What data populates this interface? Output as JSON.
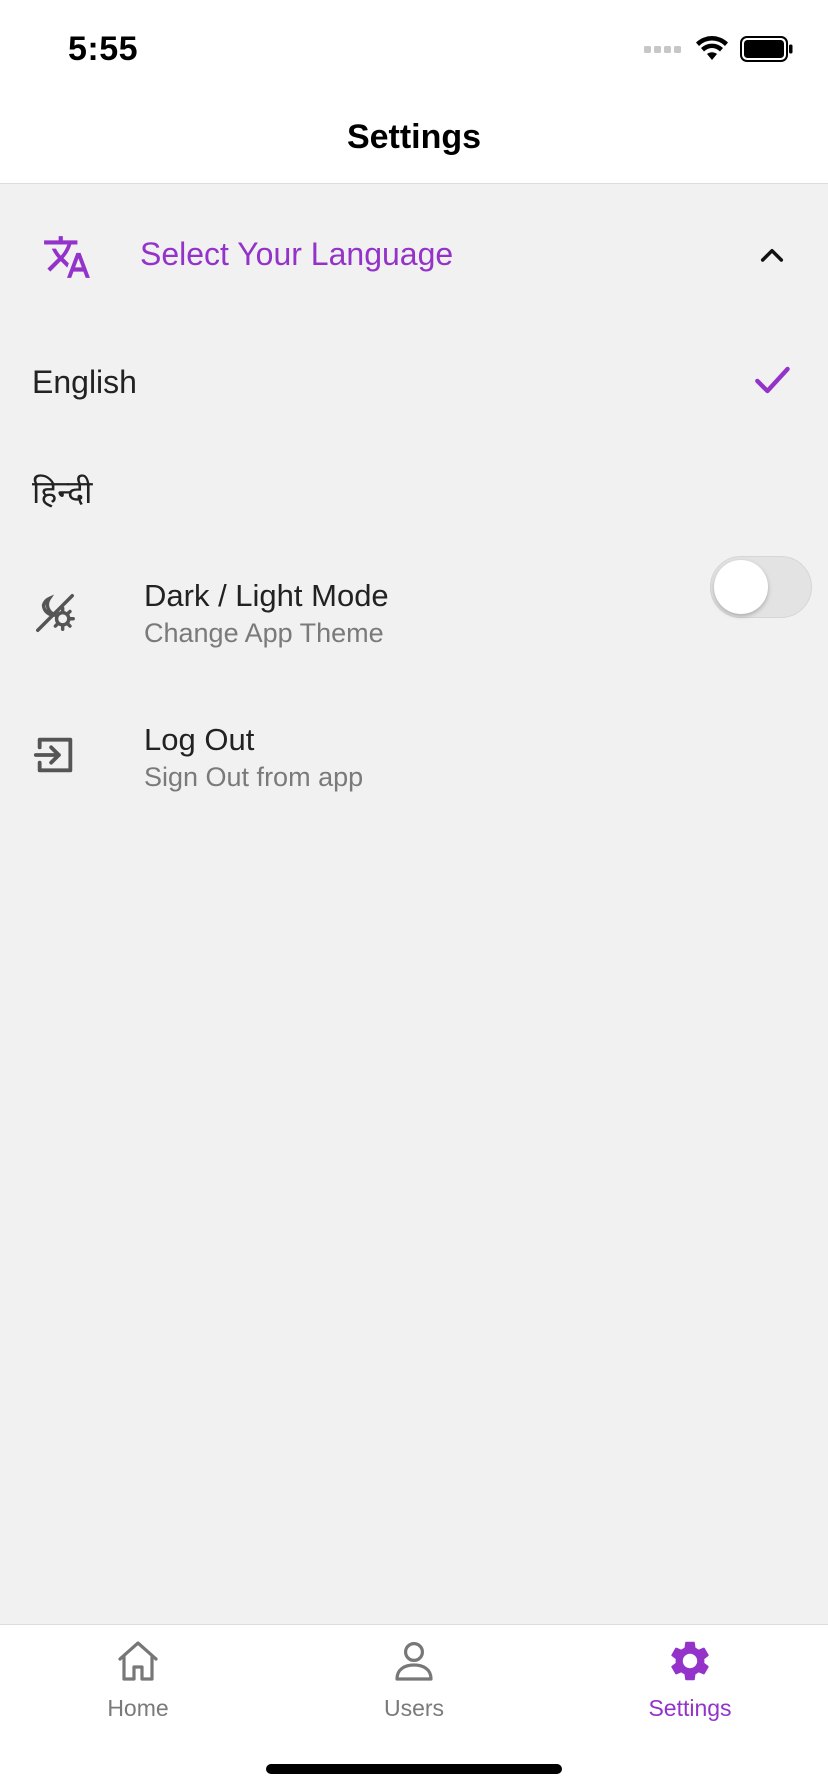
{
  "status_bar": {
    "time": "5:55"
  },
  "header": {
    "title": "Settings"
  },
  "language_section": {
    "title": "Select Your Language",
    "expanded": true,
    "options": [
      {
        "label": "English",
        "selected": true
      },
      {
        "label": "हिन्दी",
        "selected": false
      }
    ]
  },
  "theme_setting": {
    "title": "Dark / Light Mode",
    "subtitle": "Change App Theme",
    "toggle_on": false
  },
  "logout_setting": {
    "title": "Log Out",
    "subtitle": "Sign Out from app"
  },
  "tab_bar": {
    "tabs": [
      {
        "label": "Home",
        "icon": "home-icon",
        "active": false
      },
      {
        "label": "Users",
        "icon": "user-icon",
        "active": false
      },
      {
        "label": "Settings",
        "icon": "gear-icon",
        "active": true
      }
    ]
  },
  "colors": {
    "accent": "#9333c9",
    "background": "#f1f1f1",
    "secondary_text": "#7a7a7a"
  }
}
